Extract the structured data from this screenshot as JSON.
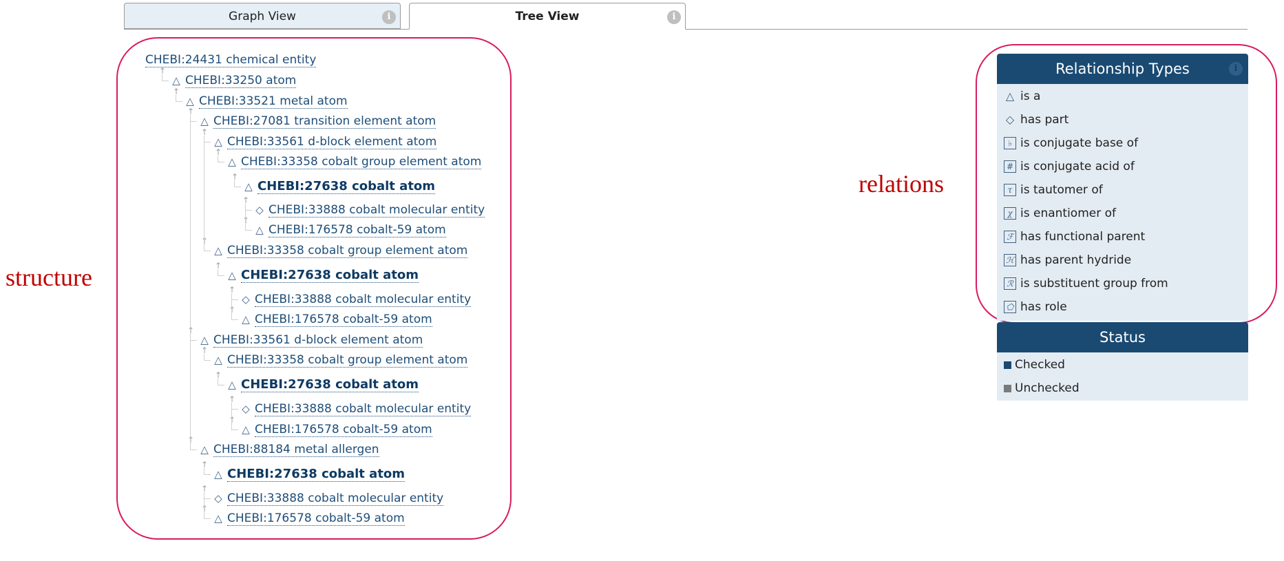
{
  "tabs": [
    {
      "label": "Graph View",
      "active": false
    },
    {
      "label": "Tree View",
      "active": true
    }
  ],
  "info_glyph": "i",
  "tree": [
    {
      "label": "CHEBI:24431 chemical entity",
      "sym": "",
      "bold": false
    },
    {
      "label": "CHEBI:33250 atom",
      "sym": "△",
      "bold": false
    },
    {
      "label": "CHEBI:33521 metal atom",
      "sym": "△",
      "bold": false
    },
    {
      "label": "CHEBI:27081 transition element atom",
      "sym": "△",
      "bold": false
    },
    {
      "label": "CHEBI:33561 d-block element atom",
      "sym": "△",
      "bold": false
    },
    {
      "label": "CHEBI:33358 cobalt group element atom",
      "sym": "△",
      "bold": false
    },
    {
      "label": "CHEBI:27638 cobalt atom",
      "sym": "△",
      "bold": true
    },
    {
      "label": "CHEBI:33888 cobalt molecular entity",
      "sym": "◇",
      "bold": false
    },
    {
      "label": "CHEBI:176578 cobalt-59 atom",
      "sym": "△",
      "bold": false
    },
    {
      "label": "CHEBI:33358 cobalt group element atom",
      "sym": "△",
      "bold": false
    },
    {
      "label": "CHEBI:27638 cobalt atom",
      "sym": "△",
      "bold": true
    },
    {
      "label": "CHEBI:33888 cobalt molecular entity",
      "sym": "◇",
      "bold": false
    },
    {
      "label": "CHEBI:176578 cobalt-59 atom",
      "sym": "△",
      "bold": false
    },
    {
      "label": "CHEBI:33561 d-block element atom",
      "sym": "△",
      "bold": false
    },
    {
      "label": "CHEBI:33358 cobalt group element atom",
      "sym": "△",
      "bold": false
    },
    {
      "label": "CHEBI:27638 cobalt atom",
      "sym": "△",
      "bold": true
    },
    {
      "label": "CHEBI:33888 cobalt molecular entity",
      "sym": "◇",
      "bold": false
    },
    {
      "label": "CHEBI:176578 cobalt-59 atom",
      "sym": "△",
      "bold": false
    },
    {
      "label": "CHEBI:88184 metal allergen",
      "sym": "△",
      "bold": false
    },
    {
      "label": "CHEBI:27638 cobalt atom",
      "sym": "△",
      "bold": true
    },
    {
      "label": "CHEBI:33888 cobalt molecular entity",
      "sym": "◇",
      "bold": false
    },
    {
      "label": "CHEBI:176578 cobalt-59 atom",
      "sym": "△",
      "bold": false
    }
  ],
  "annotations": {
    "structure": "structure",
    "relations": "relations"
  },
  "relationship_panel": {
    "title": "Relationship Types",
    "items": [
      {
        "label": "is a",
        "icon": "triangle-icon",
        "glyph": "△"
      },
      {
        "label": "has part",
        "icon": "diamond-icon",
        "glyph": "◇"
      },
      {
        "label": "is conjugate base of",
        "icon": "flat-icon",
        "glyph": "♭"
      },
      {
        "label": "is conjugate acid of",
        "icon": "sharp-icon",
        "glyph": "#"
      },
      {
        "label": "is tautomer of",
        "icon": "tau-icon",
        "glyph": "τ"
      },
      {
        "label": "is enantiomer of",
        "icon": "chi-icon",
        "glyph": "χ"
      },
      {
        "label": "has functional parent",
        "icon": "script-f-icon",
        "glyph": "ℱ"
      },
      {
        "label": "has parent hydride",
        "icon": "script-h-icon",
        "glyph": "ℋ"
      },
      {
        "label": "is substituent group from",
        "icon": "script-r-icon",
        "glyph": "ℛ"
      },
      {
        "label": "has role",
        "icon": "role-icon",
        "glyph": "⬠"
      }
    ]
  },
  "status_panel": {
    "title": "Status",
    "items": [
      {
        "label": "Checked",
        "color": "#1a4a72"
      },
      {
        "label": "Unchecked",
        "color": "#7a7a7a"
      }
    ]
  },
  "colors": {
    "accent": "#1a4a72",
    "link": "#1f4e79",
    "highlight_ring": "#d81b60",
    "annotation": "#c00000",
    "panel_bg": "#e4ecf3"
  }
}
